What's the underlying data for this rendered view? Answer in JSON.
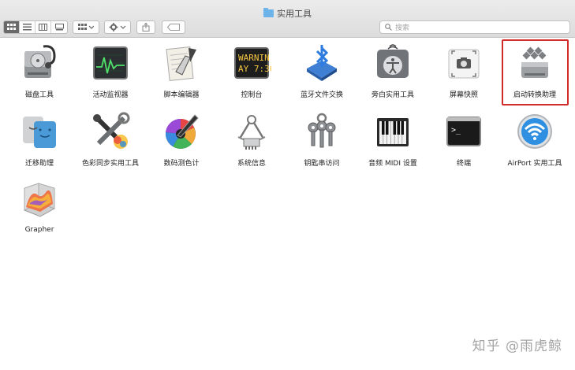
{
  "window": {
    "title": "实用工具",
    "search_placeholder": "搜索"
  },
  "apps": [
    {
      "label": "磁盘工具",
      "icon": "disk-utility-icon"
    },
    {
      "label": "活动监视器",
      "icon": "activity-monitor-icon"
    },
    {
      "label": "脚本编辑器",
      "icon": "script-editor-icon"
    },
    {
      "label": "控制台",
      "icon": "console-icon",
      "screen_text": [
        "WARNIN",
        "AY 7:36"
      ]
    },
    {
      "label": "蓝牙文件交换",
      "icon": "bluetooth-icon"
    },
    {
      "label": "旁白实用工具",
      "icon": "voiceover-utility-icon"
    },
    {
      "label": "屏幕快照",
      "icon": "screenshot-icon"
    },
    {
      "label": "启动转换助理",
      "icon": "boot-camp-icon",
      "highlighted": true
    },
    {
      "label": "迁移助理",
      "icon": "migration-assistant-icon"
    },
    {
      "label": "色彩同步实用工具",
      "icon": "colorsync-icon"
    },
    {
      "label": "数码测色计",
      "icon": "digital-color-meter-icon"
    },
    {
      "label": "系统信息",
      "icon": "system-information-icon"
    },
    {
      "label": "钥匙串访问",
      "icon": "keychain-access-icon"
    },
    {
      "label": "音频 MIDI 设置",
      "icon": "audio-midi-icon"
    },
    {
      "label": "终端",
      "icon": "terminal-icon",
      "screen_text": ">_"
    },
    {
      "label": "AirPort 实用工具",
      "icon": "airport-utility-icon"
    },
    {
      "label": "Grapher",
      "icon": "grapher-icon"
    }
  ],
  "colors": {
    "highlight": "#d32a2a",
    "folder": "#6bb3e8"
  },
  "watermark": "知乎 @雨虎鲸"
}
